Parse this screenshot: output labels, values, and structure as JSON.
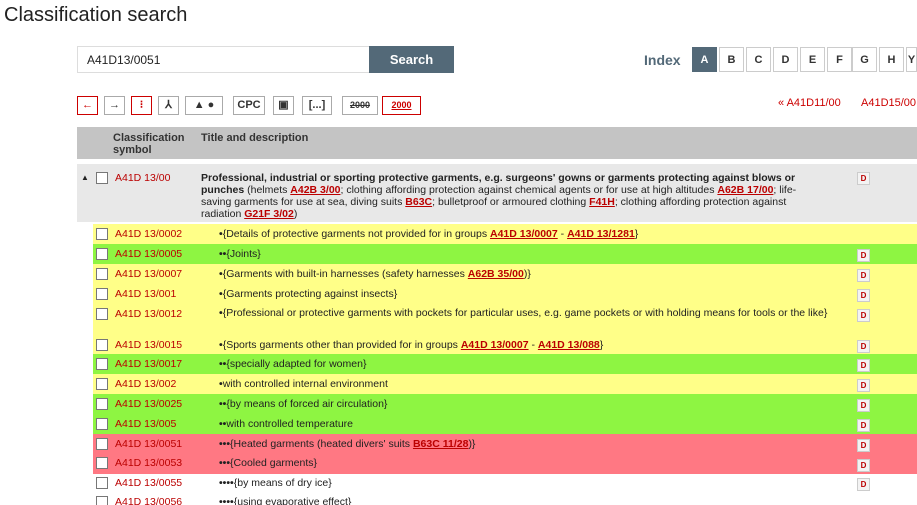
{
  "page": {
    "title": "Classification search"
  },
  "search": {
    "value": "A41D13/0051",
    "button": "Search"
  },
  "index": {
    "label": "Index",
    "letters": [
      "A",
      "B",
      "C",
      "D",
      "E",
      "F",
      "G",
      "H",
      "Y"
    ],
    "active": "A"
  },
  "toolbar": {
    "cpc": "CPC",
    "brackets": "[...]",
    "y2000a": "2000",
    "y2000b": "2000"
  },
  "nav": {
    "prev": "« A41D11/00",
    "next": "A41D15/00"
  },
  "table": {
    "col_symbol": "Classification symbol",
    "col_title": "Title and description"
  },
  "rows": [
    {
      "symbol": "A41D 13/00",
      "color": "grey",
      "dots": ""
    },
    {
      "symbol": "A41D 13/0002",
      "color": "#ffff88",
      "dots": "•"
    },
    {
      "symbol": "A41D 13/0005",
      "color": "#8ef542",
      "dots": "••"
    },
    {
      "symbol": "A41D 13/0007",
      "color": "#ffff88",
      "dots": "•"
    },
    {
      "symbol": "A41D 13/001",
      "color": "#ffff88",
      "dots": "•"
    },
    {
      "symbol": "A41D 13/0012",
      "color": "#ffff88",
      "dots": "•"
    },
    {
      "symbol": "A41D 13/0015",
      "color": "#ffff88",
      "dots": "•"
    },
    {
      "symbol": "A41D 13/0017",
      "color": "#8ef542",
      "dots": "••"
    },
    {
      "symbol": "A41D 13/002",
      "color": "#ffff88",
      "dots": "•"
    },
    {
      "symbol": "A41D 13/0025",
      "color": "#8ef542",
      "dots": "••"
    },
    {
      "symbol": "A41D 13/005",
      "color": "#8ef542",
      "dots": "••"
    },
    {
      "symbol": "A41D 13/0051",
      "color": "#ff7883",
      "dots": "•••"
    },
    {
      "symbol": "A41D 13/0053",
      "color": "#ff7883",
      "dots": "•••"
    },
    {
      "symbol": "A41D 13/0055",
      "color": "#ffffff",
      "dots": "••••"
    },
    {
      "symbol": "A41D 13/0056",
      "color": "#ffffff",
      "dots": "••••"
    }
  ],
  "text": {
    "r0a": "Professional, industrial or sporting protective garments, e.g. surgeons' gowns or garments protecting against blows or punches",
    "r0b": " (helmets ",
    "r0l1": "A42B 3/00",
    "r0c": "; clothing affording protection against chemical agents or for use at high altitudes ",
    "r0l2": "A62B 17/00",
    "r0d": "; life-saving garments for use at sea, diving suits ",
    "r0l3": "B63C",
    "r0e": "; bulletproof or armoured clothing ",
    "r0l4": "F41H",
    "r0f": "; clothing affording protection against radiation ",
    "r0l5": "G21F 3/02",
    "r0g": ")",
    "r1a": "{Details of protective garments not provided for in groups ",
    "r1l1": "A41D 13/0007",
    "r1b": " - ",
    "r1l2": "A41D 13/1281",
    "r1c": "}",
    "r2": "{Joints}",
    "r3a": "{Garments with built-in harnesses (safety harnesses ",
    "r3l1": "A62B 35/00",
    "r3b": ")}",
    "r4": "{Garments protecting against insects}",
    "r5": "{Professional or protective garments with pockets for particular uses, e.g. game pockets or with holding means for tools or the like}",
    "r6a": "{Sports garments other than provided for in groups ",
    "r6l1": "A41D 13/0007",
    "r6b": " - ",
    "r6l2": "A41D 13/088",
    "r6c": "}",
    "r7": "{specially adapted for women}",
    "r8": "with controlled internal environment",
    "r9": "{by means of forced air circulation}",
    "r10": "with controlled temperature",
    "r11a": "{Heated garments (heated divers' suits ",
    "r11l1": "B63C 11/28",
    "r11b": ")}",
    "r12": "{Cooled garments}",
    "r13": "{by means of dry ice}",
    "r14": "{using evaporative effect}",
    "d": "D"
  }
}
